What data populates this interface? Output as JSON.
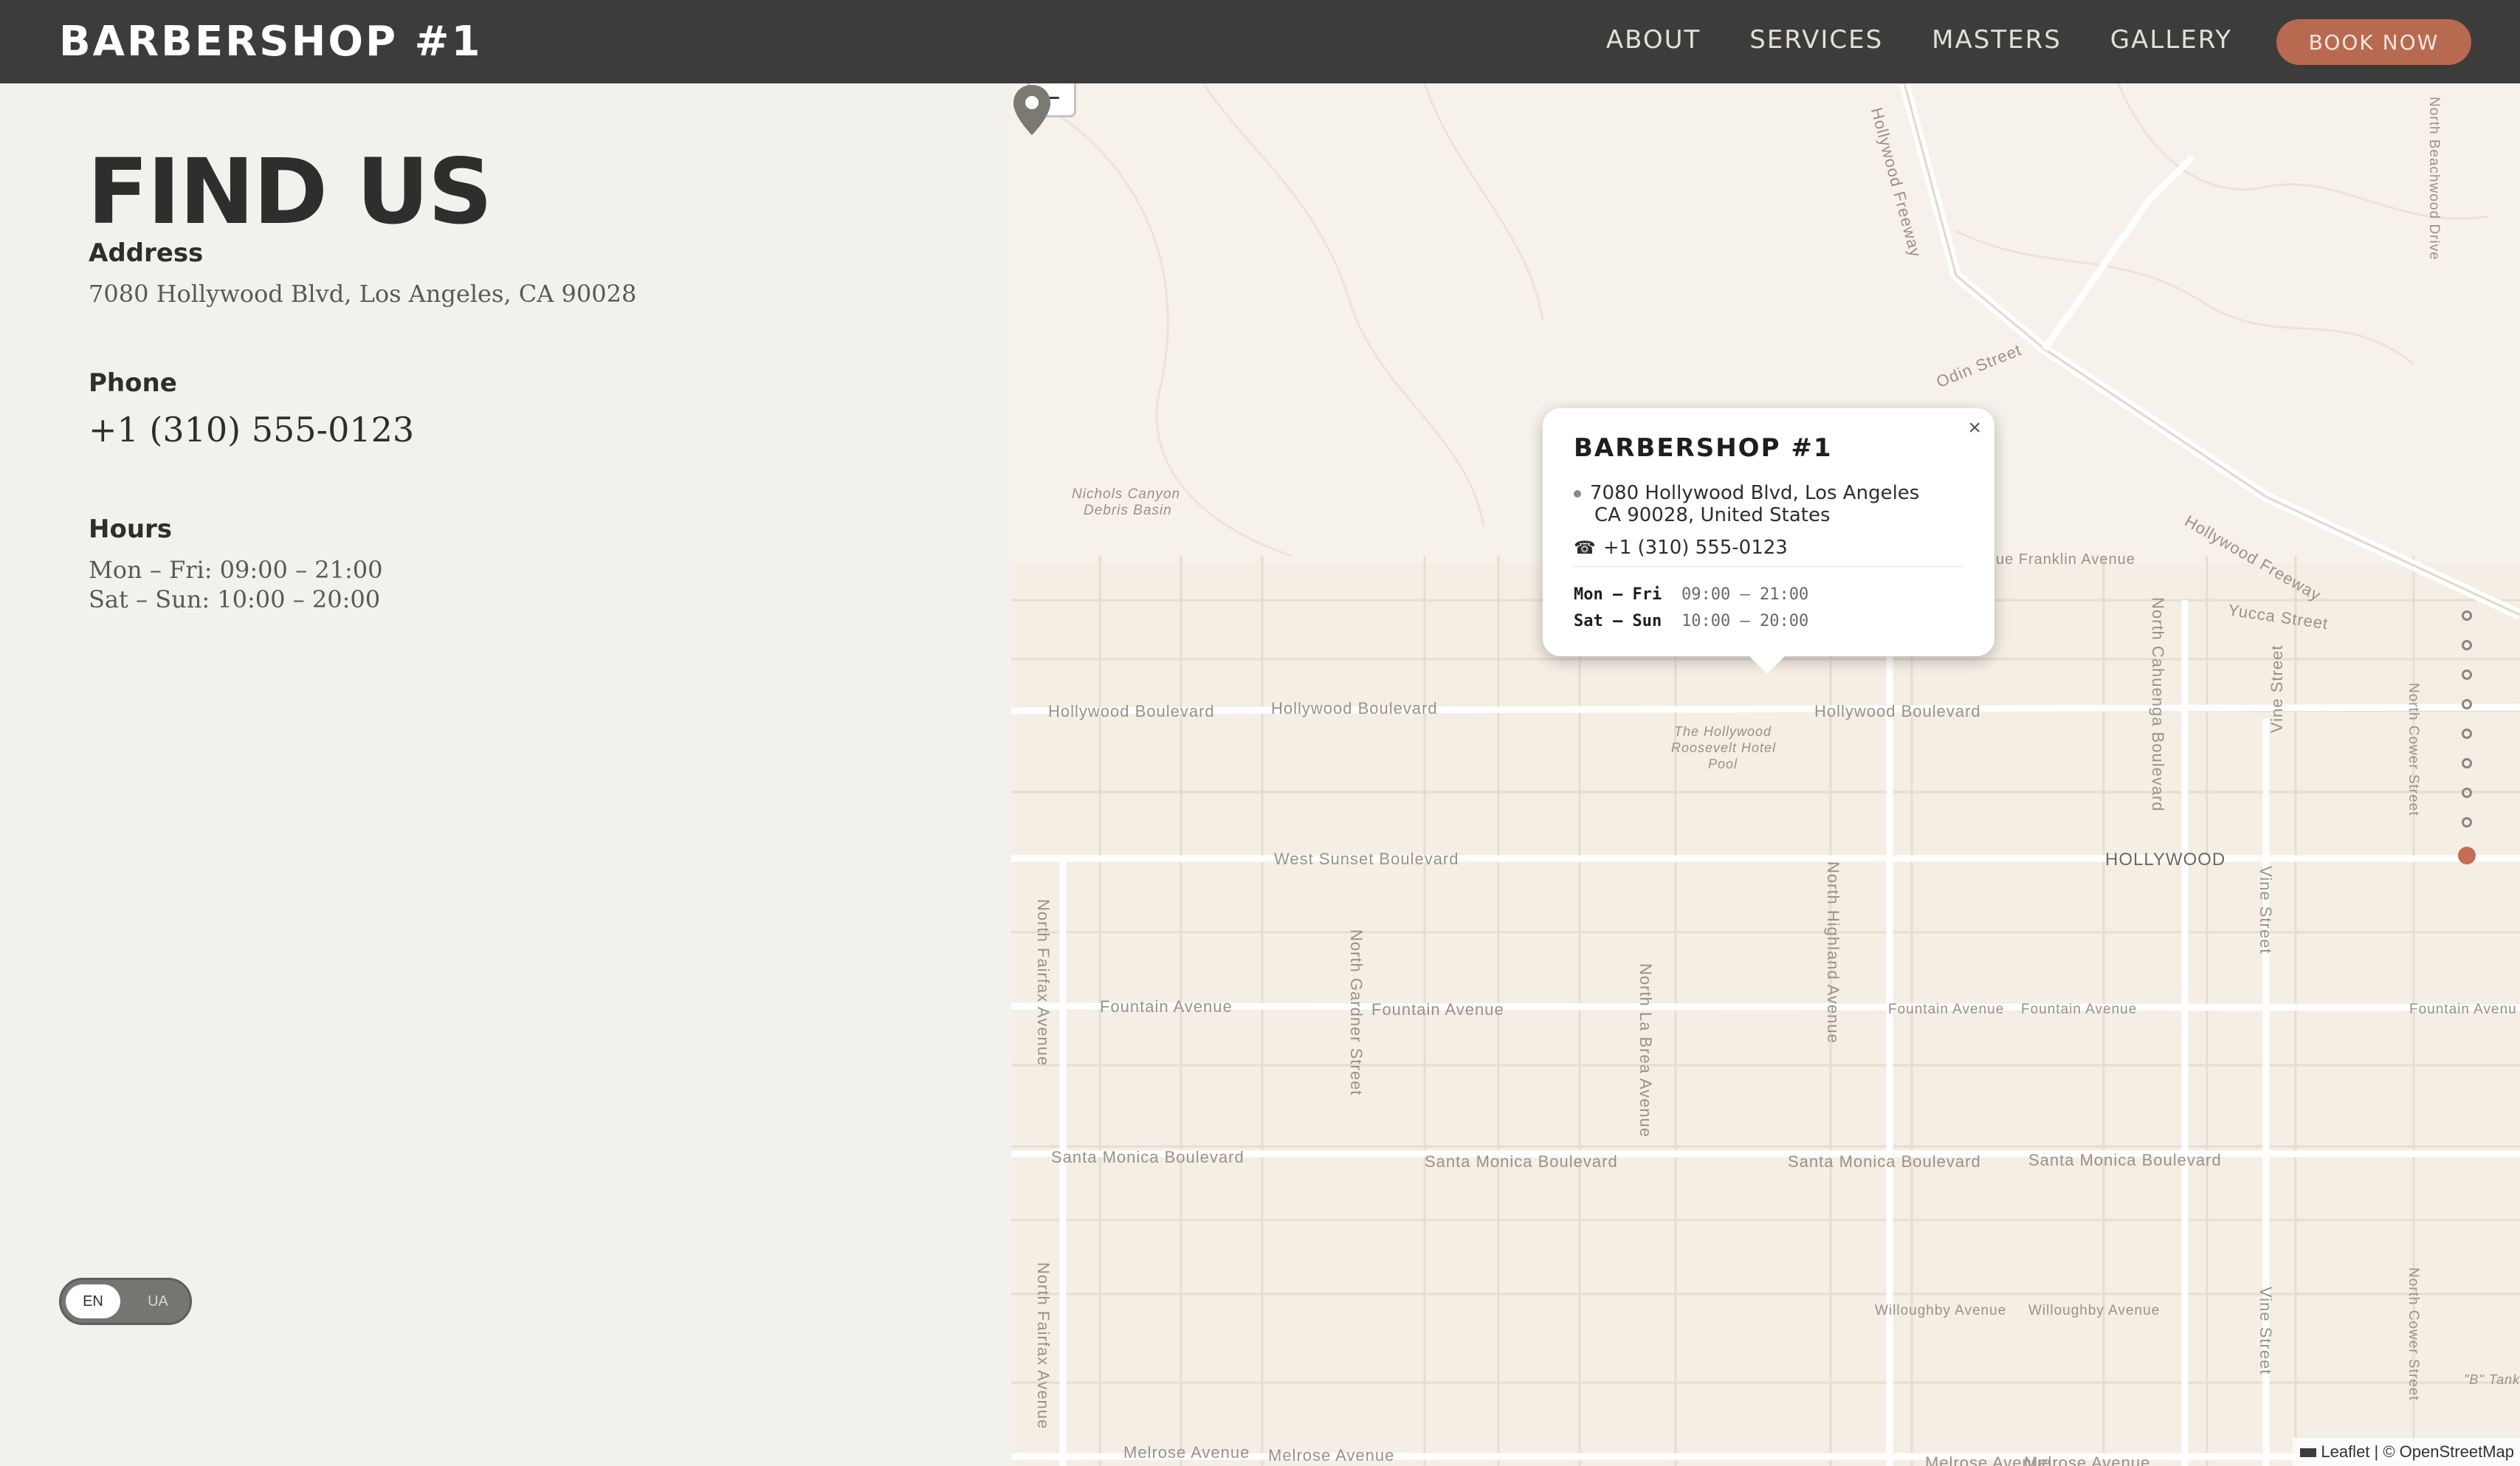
{
  "header": {
    "brand": "BARBERSHOP #1",
    "nav": [
      "ABOUT",
      "SERVICES",
      "MASTERS",
      "GALLERY"
    ],
    "book_label": "BOOK NOW"
  },
  "find_us": {
    "title": "FIND US",
    "address_label": "Address",
    "address": "7080 Hollywood Blvd, Los Angeles, CA 90028",
    "phone_label": "Phone",
    "phone": "+1 (310) 555-0123",
    "hours_label": "Hours",
    "hours": [
      "Mon – Fri: 09:00 – 21:00",
      "Sat – Sun: 10:00 – 20:00"
    ]
  },
  "language": {
    "active": "EN",
    "other": "UA"
  },
  "map": {
    "zoom_out": "−",
    "labels": {
      "hollywood_freeway_top": "Hollywood Freeway",
      "odin_street": "Odin Street",
      "nichols_canyon_1": "Nichols Canyon",
      "nichols_canyon_2": "Debris Basin",
      "franklin": "ue Franklin Avenue",
      "hollywood_freeway_right": "Hollywood Freeway",
      "yucca": "Yucca Street",
      "hollywood_blvd_1": "Hollywood Boulevard",
      "hollywood_blvd_2": "Hollywood Boulevard",
      "hollywood_blvd_3": "Hollywood Boulevard",
      "roosevelt_1": "The Hollywood",
      "roosevelt_2": "Roosevelt Hotel",
      "roosevelt_3": "Pool",
      "sunset": "West Sunset Boulevard",
      "hollywood_district": "HOLLYWOOD",
      "fountain_1": "Fountain Avenue",
      "fountain_2": "Fountain Avenue",
      "fountain_3": "Fountain Avenue",
      "fountain_4": "Fountain Avenue",
      "fountain_5": "Fountain Avenue",
      "santa_monica_1": "Santa Monica Boulevard",
      "santa_monica_2": "Santa Monica Boulevard",
      "santa_monica_3": "Santa Monica Boulevard",
      "santa_monica_4": "Santa Monica Boulevard",
      "willoughby_1": "Willoughby Avenue",
      "willoughby_2": "Willoughby Avenue",
      "melrose_1": "Melrose Avenue",
      "melrose_2": "Melrose Avenue",
      "melrose_3": "Melrose Avenue",
      "melrose_4": "Melrose Avenue",
      "n_fairfax_1": "North Fairfax Avenue",
      "n_fairfax_2": "North Fairfax Avenue",
      "n_gardner": "North Gardner Street",
      "n_la_brea": "North La Brea Avenue",
      "n_highland": "North Highland Avenue",
      "n_cahuenga": "North Cahuenga Boulevard",
      "vine_1": "Vine Street",
      "vine_2": "Vine Street",
      "vine_3": "Vine Street",
      "n_cower_1": "North Cower Street",
      "n_cower_2": "North Cower Street",
      "n_beachwood": "North Beachwood Drive",
      "fountain_ave_right": "Fountain Avenu",
      "b_tank": "\"B\" Tank"
    },
    "popup": {
      "close": "×",
      "title": "BARBERSHOP #1",
      "address_line1": "7080 Hollywood Blvd, Los Angeles",
      "address_line2": "CA 90028, United States",
      "phone": "+1 (310) 555-0123",
      "hours": [
        {
          "days": "Mon – Fri",
          "time": "09:00 – 21:00"
        },
        {
          "days": "Sat – Sun",
          "time": "10:00 – 20:00"
        }
      ]
    },
    "attribution": "Leaflet | © OpenStreetMap"
  },
  "section_dots": {
    "count": 9,
    "active_index": 8
  },
  "colors": {
    "nav_bg": "#3d3c3a",
    "accent": "#c46f55",
    "page_bg": "#f3f1ed",
    "map_bg": "#f4eee5"
  }
}
